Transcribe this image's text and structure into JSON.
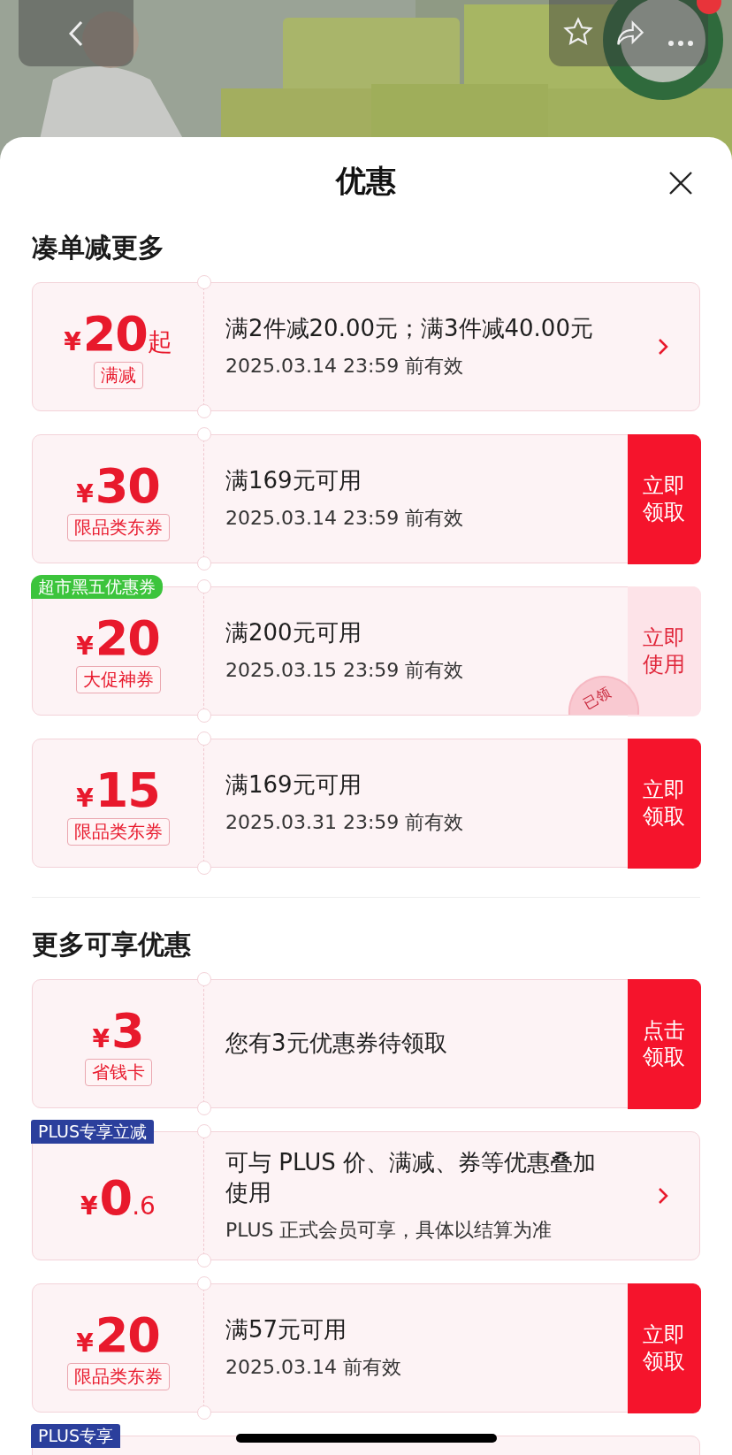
{
  "sheet": {
    "title": "优惠"
  },
  "sections": [
    {
      "title": "凑单减更多",
      "coupons": [
        {
          "currency": "¥",
          "amount": "20",
          "suffix": "起",
          "tag": "满减",
          "lines": [
            "满2件减20.00元；满3件减40.00元",
            "2025.03.14 23:59 前有效"
          ],
          "action": {
            "kind": "arrow"
          }
        },
        {
          "currency": "¥",
          "amount": "30",
          "tag": "限品类东券",
          "lines": [
            "满169元可用",
            "2025.03.14 23:59 前有效"
          ],
          "action": {
            "kind": "button",
            "label": "立即领取",
            "filled": true
          }
        },
        {
          "currency": "¥",
          "amount": "20",
          "tag": "大促神券",
          "badge": {
            "text": "超市黑五优惠券",
            "color": "#3cc43c"
          },
          "lines": [
            "满200元可用",
            "2025.03.15 23:59 前有效"
          ],
          "action": {
            "kind": "button",
            "label": "立即使用",
            "filled": false
          },
          "stamp": "已领"
        },
        {
          "currency": "¥",
          "amount": "15",
          "tag": "限品类东券",
          "lines": [
            "满169元可用",
            "2025.03.31 23:59 前有效"
          ],
          "action": {
            "kind": "button",
            "label": "立即领取",
            "filled": true
          }
        }
      ]
    },
    {
      "title": "更多可享优惠",
      "coupons": [
        {
          "currency": "¥",
          "amount": "3",
          "tag": "省钱卡",
          "lines": [
            "您有3元优惠券待领取"
          ],
          "action": {
            "kind": "button",
            "label": "点击领取",
            "filled": true
          }
        },
        {
          "currency": "¥",
          "amount": "0",
          "decimal": ".6",
          "badge": {
            "text": "PLUS专享立减",
            "color": "#2b3f9c"
          },
          "lines": [
            "可与 PLUS 价、满减、券等优惠叠加使用",
            "PLUS 正式会员可享，具体以结算为准"
          ],
          "action": {
            "kind": "arrow"
          }
        },
        {
          "currency": "¥",
          "amount": "20",
          "tag": "限品类东券",
          "lines": [
            "满57元可用",
            "2025.03.14 前有效"
          ],
          "action": {
            "kind": "button",
            "label": "立即领取",
            "filled": true
          }
        },
        {
          "badge": {
            "text": "PLUS专享",
            "color": "#2b3f9c"
          }
        }
      ]
    }
  ]
}
